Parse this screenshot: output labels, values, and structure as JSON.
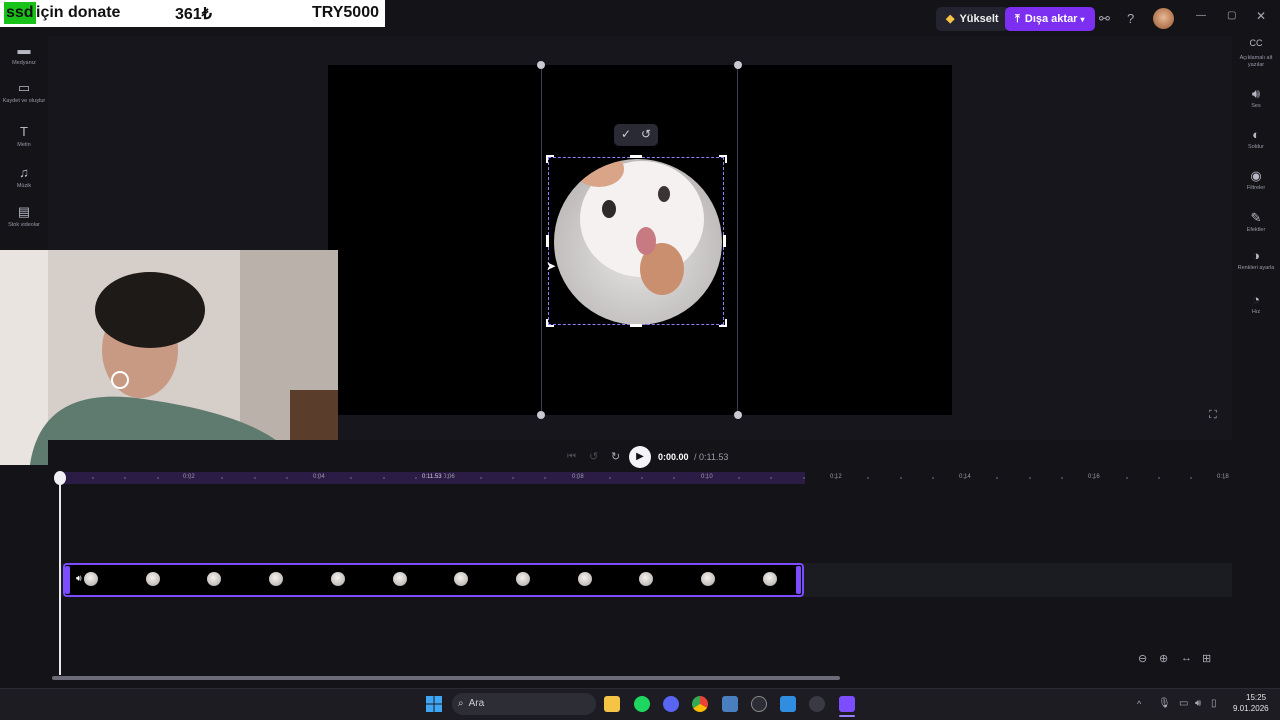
{
  "overlay": {
    "tag": "ssd",
    "text": "için donate",
    "amount": "361₺",
    "goal": "TRY5000"
  },
  "header": {
    "upgrade_label": "Yükselt",
    "export_label": "Dışa aktar",
    "help_icon": "?"
  },
  "left_sidebar": {
    "items": [
      {
        "label": "Medyanız",
        "icon": "folder-icon"
      },
      {
        "label": "Kaydet ve oluştur",
        "icon": "camera-icon"
      },
      {
        "label": "Metin",
        "icon": "text-icon"
      },
      {
        "label": "Müzik",
        "icon": "music-icon"
      },
      {
        "label": "Stok videolar",
        "icon": "stock-video-icon"
      }
    ]
  },
  "right_sidebar": {
    "items": [
      {
        "label": "Açıklamalı alt yazılar",
        "icon": "captions-icon"
      },
      {
        "label": "Ses",
        "icon": "audio-icon"
      },
      {
        "label": "Soldur",
        "icon": "fade-icon"
      },
      {
        "label": "Filtreler",
        "icon": "filters-icon"
      },
      {
        "label": "Efektler",
        "icon": "effects-icon"
      },
      {
        "label": "Renkleri ayarla",
        "icon": "color-adjust-icon"
      },
      {
        "label": "Hız",
        "icon": "speed-icon"
      }
    ]
  },
  "playback": {
    "current_time": "0:00.00",
    "total_time": "/ 0:11.53"
  },
  "timeline": {
    "ticks": [
      "0:02",
      "0:04",
      "0:06",
      "0:08",
      "0:10",
      "0:12",
      "0:14",
      "0:16",
      "0:18"
    ],
    "clip_end_label": "0:11.53",
    "thumbnail_count": 12
  },
  "taskbar": {
    "search_placeholder": "Ara",
    "time": "15:25",
    "date": "9.01.2026"
  },
  "colors": {
    "accent": "#7c4dff",
    "export": "#7c2ff0",
    "donate_tag": "#19c219"
  }
}
